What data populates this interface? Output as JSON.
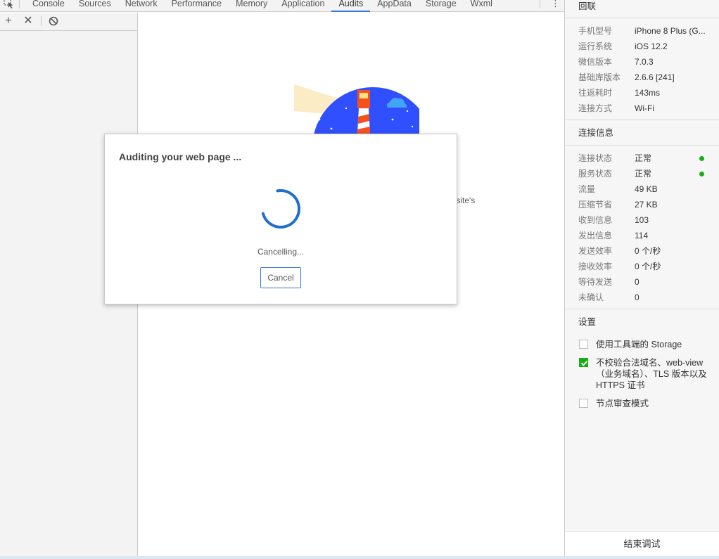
{
  "tabs": [
    {
      "label": "Console",
      "active": false
    },
    {
      "label": "Sources",
      "active": false
    },
    {
      "label": "Network",
      "active": false
    },
    {
      "label": "Performance",
      "active": false
    },
    {
      "label": "Memory",
      "active": false
    },
    {
      "label": "Application",
      "active": false
    },
    {
      "label": "Audits",
      "active": true
    },
    {
      "label": "AppData",
      "active": false
    },
    {
      "label": "Storage",
      "active": false
    },
    {
      "label": "Wxml",
      "active": false
    }
  ],
  "main": {
    "background_text": "r site's"
  },
  "modal": {
    "title": "Auditing your web page ...",
    "status": "Cancelling...",
    "cancel_label": "Cancel"
  },
  "right": {
    "top_title": "回联",
    "device_rows": [
      {
        "key": "手机型号",
        "value": "iPhone 8 Plus (G..."
      },
      {
        "key": "运行系统",
        "value": "iOS 12.2"
      },
      {
        "key": "微信版本",
        "value": "7.0.3"
      },
      {
        "key": "基础库版本",
        "value": "2.6.6 [241]"
      },
      {
        "key": "往返耗时",
        "value": "143ms"
      },
      {
        "key": "连接方式",
        "value": "Wi-Fi"
      }
    ],
    "conn_title": "连接信息",
    "conn_rows": [
      {
        "key": "连接状态",
        "value": "正常",
        "dot": true
      },
      {
        "key": "服务状态",
        "value": "正常",
        "dot": true
      },
      {
        "key": "流量",
        "value": "49 KB"
      },
      {
        "key": "压缩节省",
        "value": "27 KB"
      },
      {
        "key": "收到信息",
        "value": "103"
      },
      {
        "key": "发出信息",
        "value": "114"
      },
      {
        "key": "发送效率",
        "value": "0 个/秒"
      },
      {
        "key": "接收效率",
        "value": "0 个/秒"
      },
      {
        "key": "等待发送",
        "value": "0"
      },
      {
        "key": "未确认",
        "value": "0"
      }
    ],
    "settings_title": "设置",
    "settings": [
      {
        "label": "使用工具端的 Storage",
        "checked": false
      },
      {
        "label": "不校验合法域名、web-view（业务域名）、TLS 版本以及 HTTPS 证书",
        "checked": true
      },
      {
        "label": "节点审查模式",
        "checked": false
      }
    ],
    "footer_label": "结束调试"
  },
  "colors": {
    "accent": "#3879d9",
    "status_ok": "#1aad19",
    "lighthouse_sky": "#304ffe"
  }
}
